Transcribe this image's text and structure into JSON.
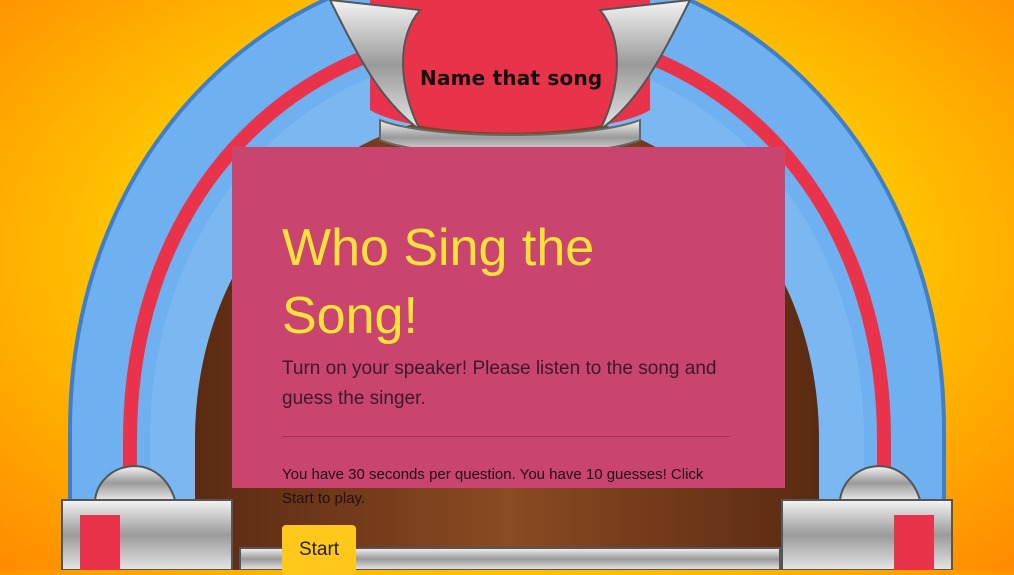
{
  "marquee": {
    "text": "Name that song"
  },
  "card": {
    "title": "Who Sing the Song!",
    "lead": "Turn on your speaker! Please listen to the song and guess the singer.",
    "info": "You have 30 seconds per question. You have 10 guesses! Click Start to play."
  },
  "actions": {
    "start_label": "Start"
  },
  "colors": {
    "background": "#ffd000",
    "card": "#c9446f",
    "title": "#ffe33a",
    "button": "#ffc81a",
    "arch_blue": "#6fb0f0",
    "arch_red": "#e8334a"
  }
}
